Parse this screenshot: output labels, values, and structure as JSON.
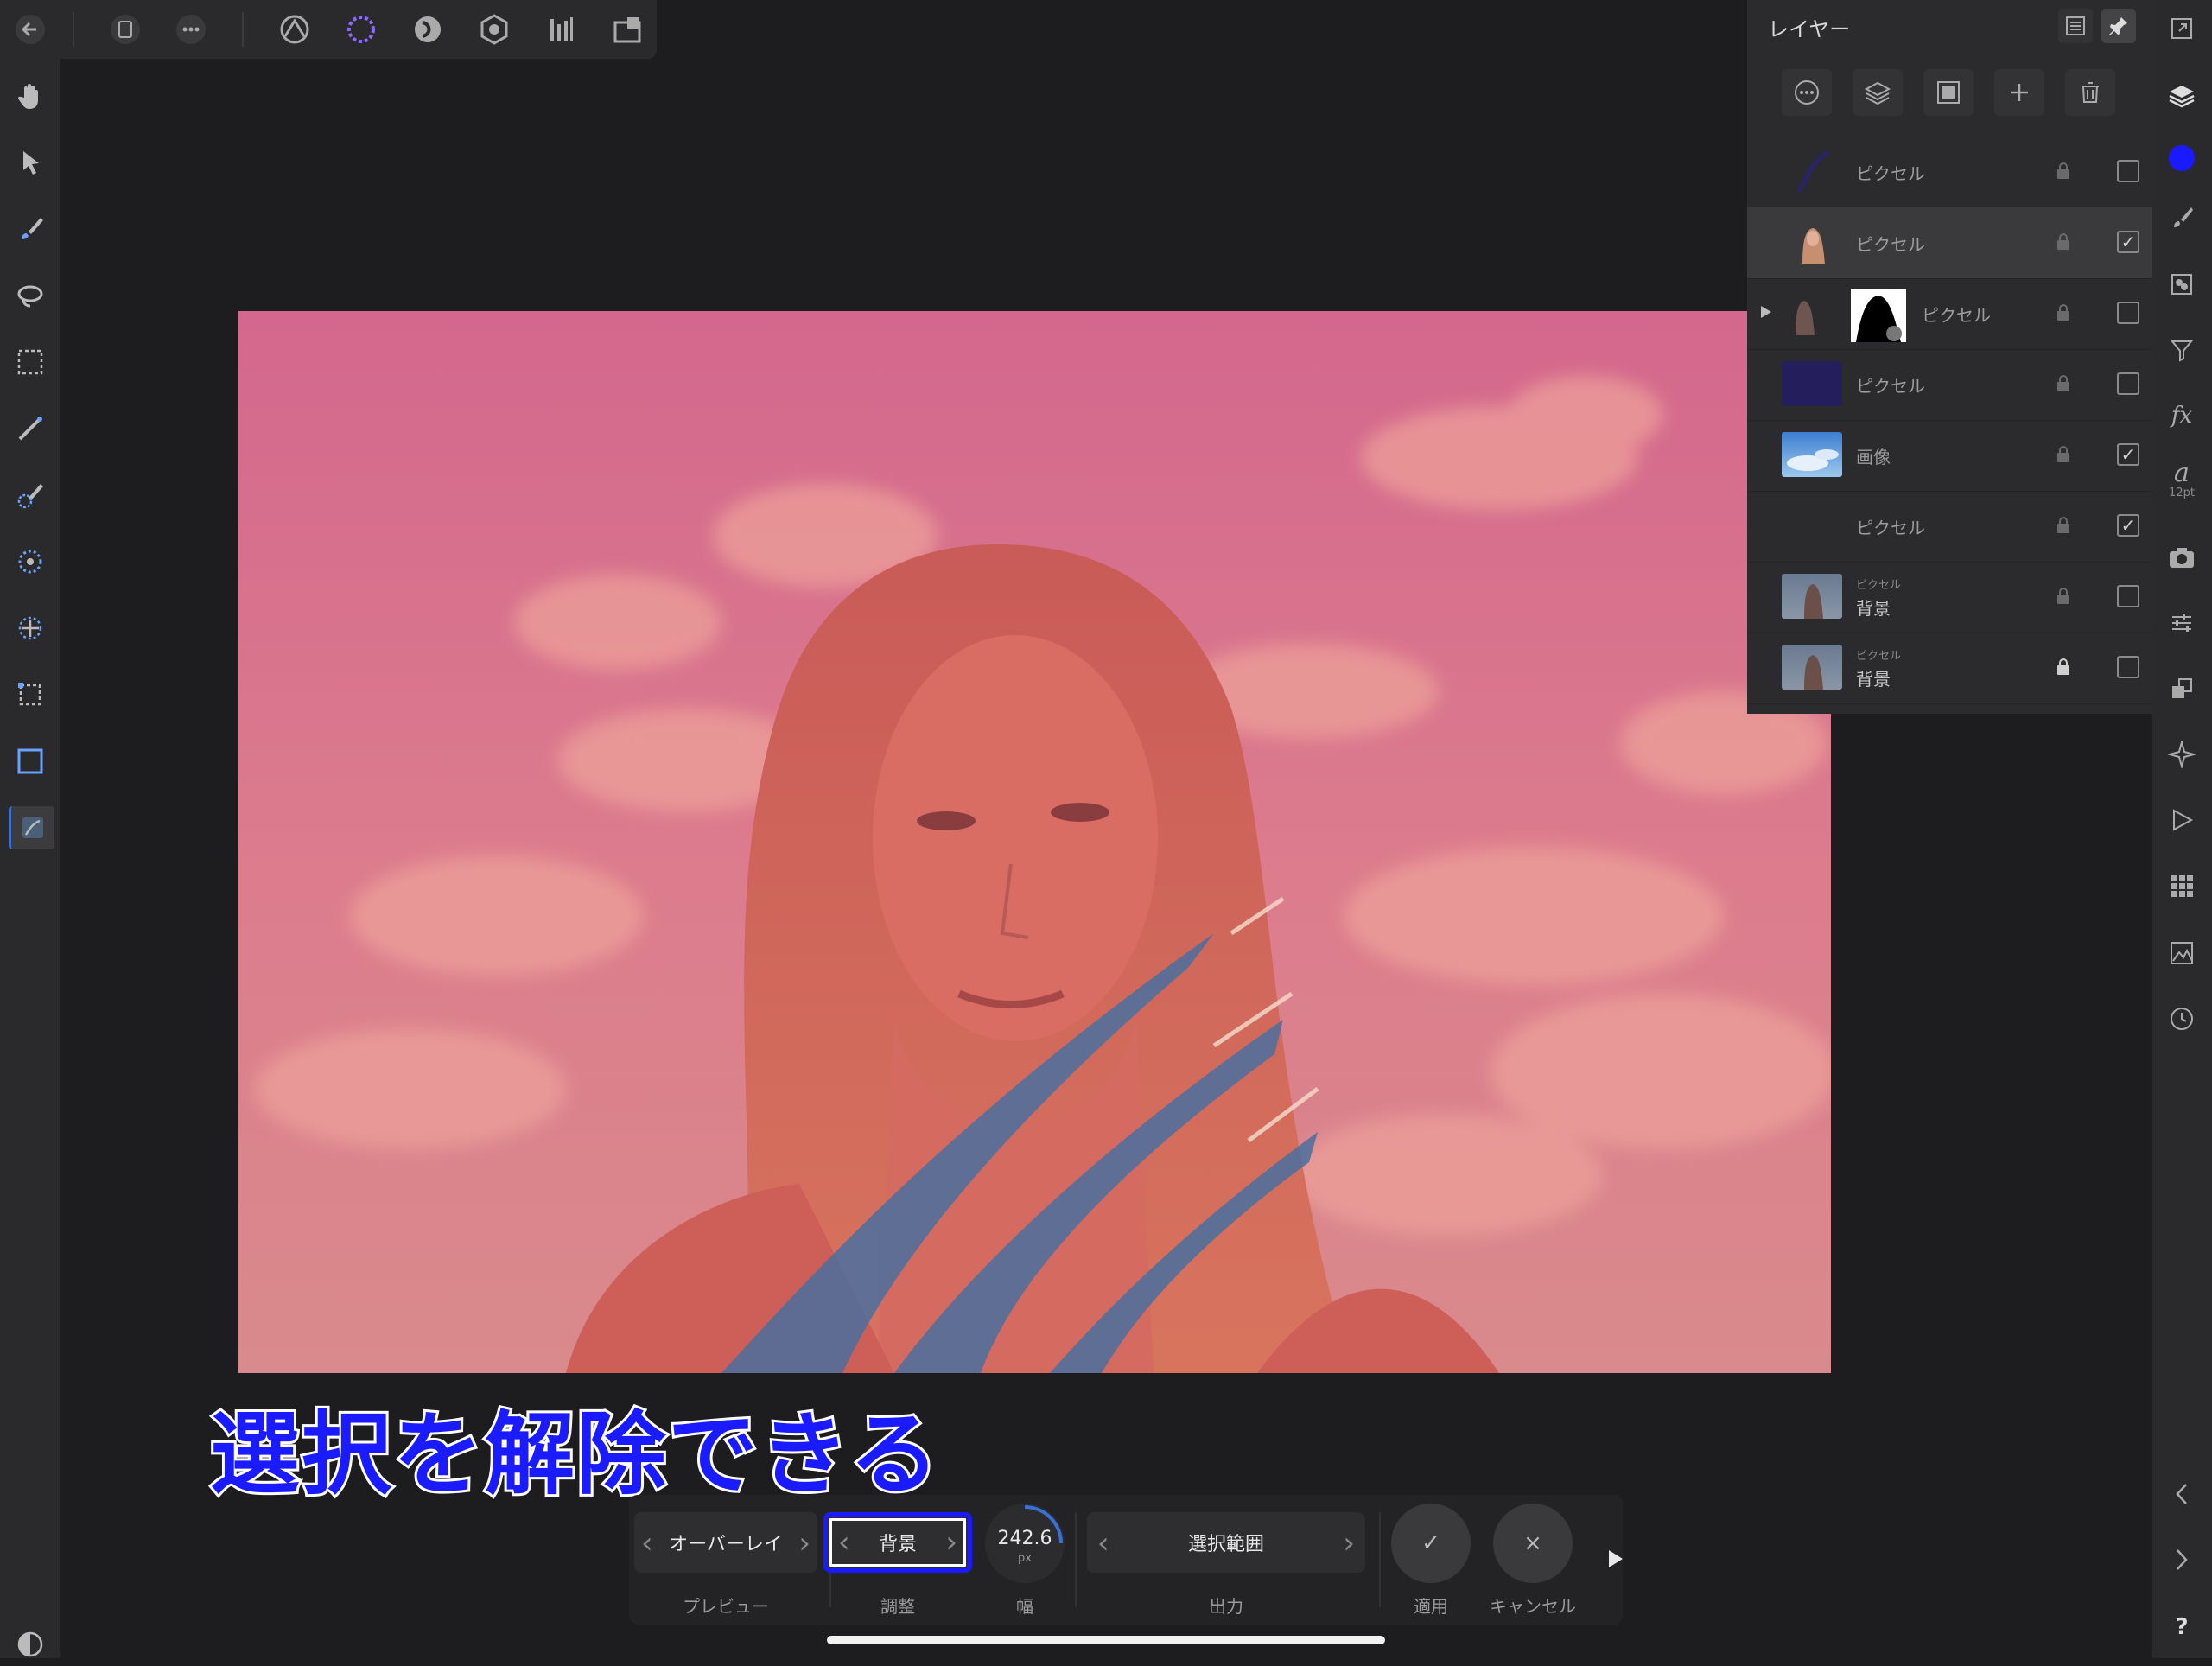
{
  "top_toolbar": {
    "icons": [
      "back-arrow-icon",
      "document-icon",
      "more-icon",
      "photo-persona-icon",
      "selection-persona-icon",
      "liquify-persona-icon",
      "develop-persona-icon",
      "tone-mapping-persona-icon",
      "export-persona-icon"
    ]
  },
  "left_toolbar": {
    "tools": [
      "hand-tool",
      "move-tool",
      "paint-brush-tool",
      "freehand-selection-tool",
      "marquee-selection-tool",
      "flood-select-tool",
      "selection-brush-tool",
      "refine-tool",
      "transform-tool",
      "rectangle-select-tool",
      "rect-select-alt-tool",
      "active-selection-tool"
    ]
  },
  "caption": {
    "text": "選択を解除できる"
  },
  "context_toolbar": {
    "preview": {
      "value": "オーバーレイ",
      "label": "プレビュー"
    },
    "adjust": {
      "value": "背景",
      "label": "調整"
    },
    "width": {
      "value": "242.6",
      "unit": "px",
      "label": "幅"
    },
    "output": {
      "value": "選択範囲",
      "label": "出力"
    },
    "apply": {
      "symbol": "✓",
      "label": "適用"
    },
    "cancel": {
      "symbol": "×",
      "label": "キャンセル"
    }
  },
  "layers_panel": {
    "title": "レイヤー",
    "layers": [
      {
        "name": "ピクセル",
        "subtitle": "",
        "checked": false,
        "thumb": "dark-blue-stroke"
      },
      {
        "name": "ピクセル",
        "subtitle": "",
        "checked": true,
        "thumb": "portrait"
      },
      {
        "name": "ピクセル",
        "subtitle": "",
        "checked": false,
        "thumb": "portrait-with-mask"
      },
      {
        "name": "ピクセル",
        "subtitle": "",
        "checked": false,
        "thumb": "navy-fill"
      },
      {
        "name": "画像",
        "subtitle": "",
        "checked": true,
        "thumb": "sky"
      },
      {
        "name": "ピクセル",
        "subtitle": "",
        "checked": true,
        "thumb": "empty"
      },
      {
        "name": "背景",
        "subtitle": "ピクセル",
        "checked": false,
        "thumb": "portrait-small"
      },
      {
        "name": "背景",
        "subtitle": "ピクセル",
        "checked": false,
        "thumb": "portrait-small"
      }
    ]
  },
  "right_toolbar": {
    "text_size": "12pt",
    "help": "?",
    "accent_color": "#1a1aff"
  }
}
